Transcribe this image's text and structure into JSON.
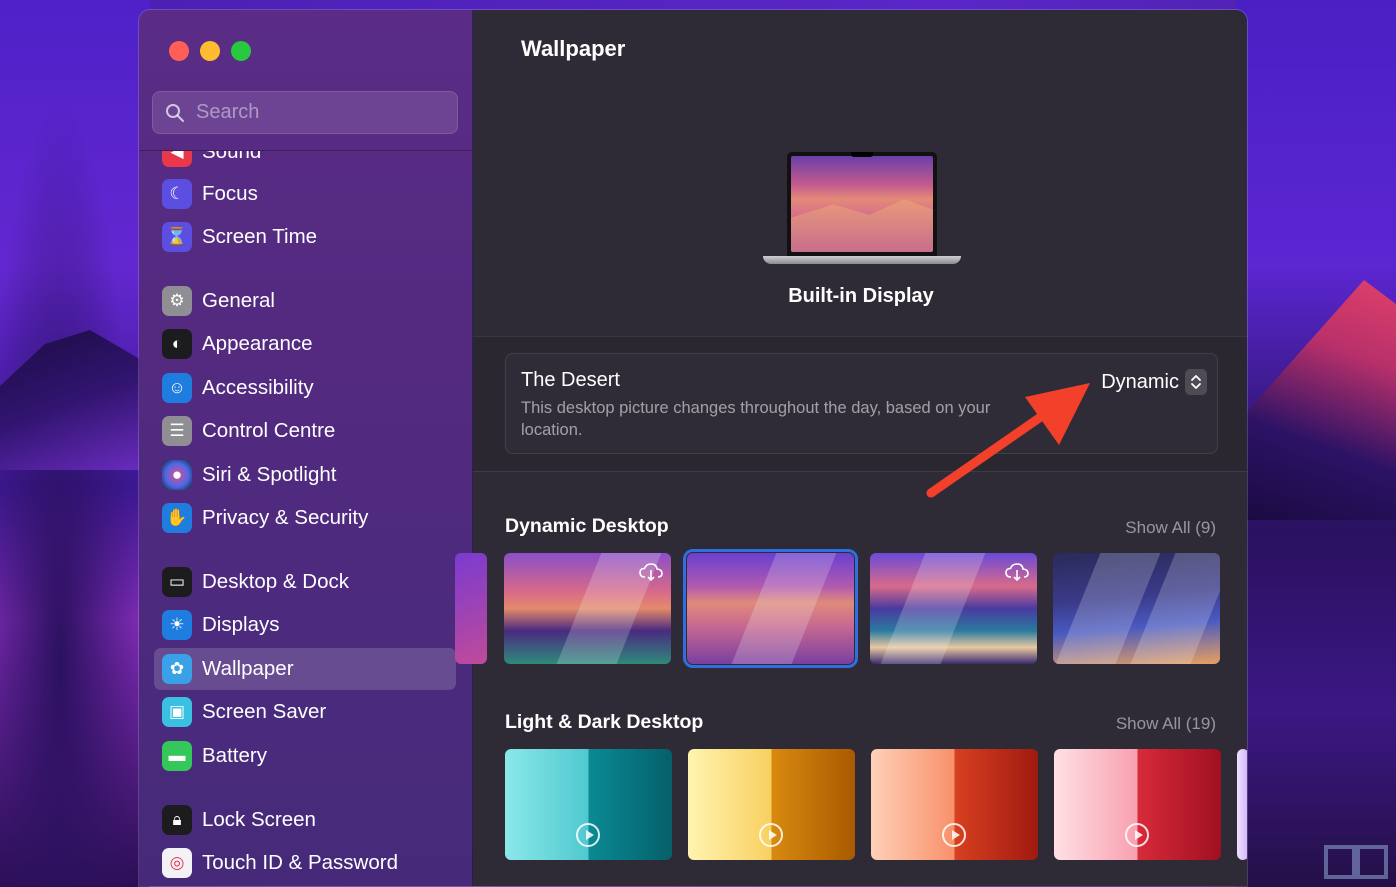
{
  "colors": {
    "selection_outline": "#2f6fe0",
    "annotation_arrow": "#f2402a"
  },
  "search": {
    "placeholder": "Search"
  },
  "sidebar": {
    "items": [
      {
        "label": "Sound",
        "icon": "speaker-icon",
        "color": "#e8384a"
      },
      {
        "label": "Focus",
        "icon": "moon-icon",
        "color": "#5b4ee0"
      },
      {
        "label": "Screen Time",
        "icon": "hourglass-icon",
        "color": "#5b4ee0"
      },
      {
        "label": "General",
        "icon": "gear-icon",
        "color": "#8e8e93"
      },
      {
        "label": "Appearance",
        "icon": "appearance-icon",
        "color": "#1c1c1e"
      },
      {
        "label": "Accessibility",
        "icon": "accessibility-icon",
        "color": "#1f7de0"
      },
      {
        "label": "Control Centre",
        "icon": "toggles-icon",
        "color": "#8e8e93"
      },
      {
        "label": "Siri & Spotlight",
        "icon": "siri-icon",
        "color": "#1a1a2e"
      },
      {
        "label": "Privacy & Security",
        "icon": "hand-icon",
        "color": "#1f7de0"
      },
      {
        "label": "Desktop & Dock",
        "icon": "dock-icon",
        "color": "#1c1c1e"
      },
      {
        "label": "Displays",
        "icon": "sun-icon",
        "color": "#1f7de0"
      },
      {
        "label": "Wallpaper",
        "icon": "flower-icon",
        "color": "#3aa0e8"
      },
      {
        "label": "Screen Saver",
        "icon": "screensaver-icon",
        "color": "#3ac0e0"
      },
      {
        "label": "Battery",
        "icon": "battery-icon",
        "color": "#34c759"
      },
      {
        "label": "Lock Screen",
        "icon": "lock-icon",
        "color": "#1c1c1e"
      },
      {
        "label": "Touch ID & Password",
        "icon": "fingerprint-icon",
        "color": "#f2f2f7"
      }
    ],
    "selected": "Wallpaper"
  },
  "main": {
    "title": "Wallpaper",
    "display_name": "Built-in Display",
    "current_wallpaper": {
      "name": "The Desert",
      "description": "This desktop picture changes throughout the day, based on your location.",
      "mode": "Dynamic"
    },
    "sections": [
      {
        "title": "Dynamic Desktop",
        "show_all": "Show All (9)",
        "thumbnails": [
          "Peak",
          "The Desert",
          "Coast",
          "Gradient"
        ]
      },
      {
        "title": "Light & Dark Desktop",
        "show_all": "Show All (19)",
        "thumbnails": [
          "Teal",
          "Yellow",
          "Orange",
          "Red"
        ]
      }
    ]
  }
}
